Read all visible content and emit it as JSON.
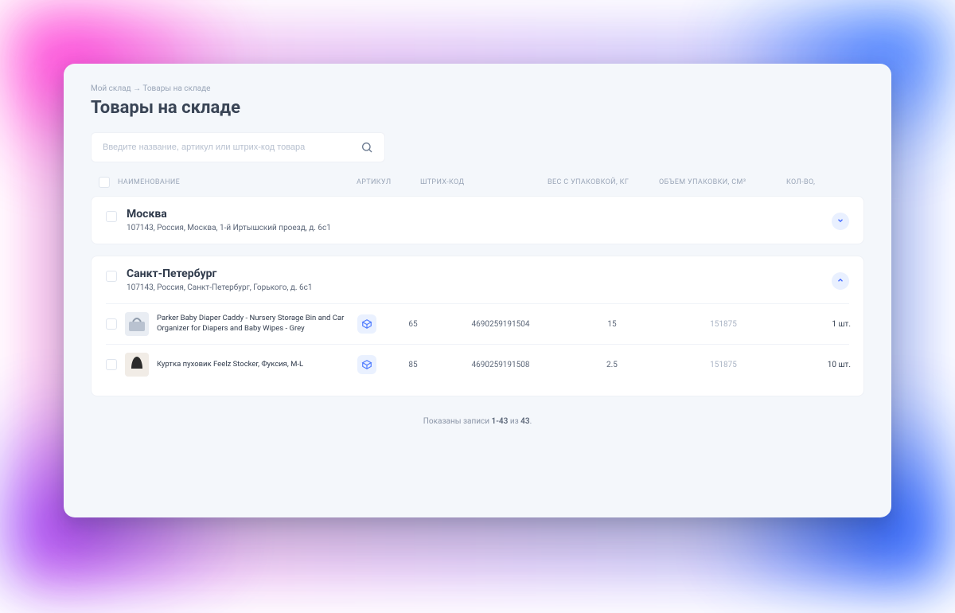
{
  "breadcrumb": {
    "root": "Мой склад",
    "sep": "→",
    "current": "Товары на складе"
  },
  "page": {
    "title": "Товары на складе"
  },
  "search": {
    "placeholder": "Введите название, артикул или штрих-код товара"
  },
  "columns": {
    "name": "НАИМЕНОВАНИЕ",
    "sku": "АРТИКУЛ",
    "barcode": "ШТРИХ-КОД",
    "weight": "ВЕС С УПАКОВКОЙ, КГ",
    "volume": "ОБЪЕМ УПАКОВКИ, СМ³",
    "qty": "КОЛ-ВО,"
  },
  "groups": [
    {
      "name": "Москва",
      "address": "107143, Россия, Москва, 1-й Иртышский проезд, д. 6с1",
      "expanded": false
    },
    {
      "name": "Санкт-Петербург",
      "address": "107143, Россия, Санкт-Петербург, Горького, д. 6с1",
      "expanded": true,
      "rows": [
        {
          "name": "Parker Baby Diaper Caddy - Nursery Storage Bin and Car Organizer for Diapers and Baby Wipes - Grey",
          "sku": "65",
          "barcode": "4690259191504",
          "weight": "15",
          "volume": "151875",
          "qty": "1 шт."
        },
        {
          "name": "Куртка пуховик Feelz Stocker, Фуксия, M-L",
          "sku": "85",
          "barcode": "4690259191508",
          "weight": "2.5",
          "volume": "151875",
          "qty": "10 шт."
        }
      ]
    }
  ],
  "pagination": {
    "prefix": "Показаны записи ",
    "range": "1-43",
    "middle": " из ",
    "total": "43",
    "suffix": "."
  }
}
